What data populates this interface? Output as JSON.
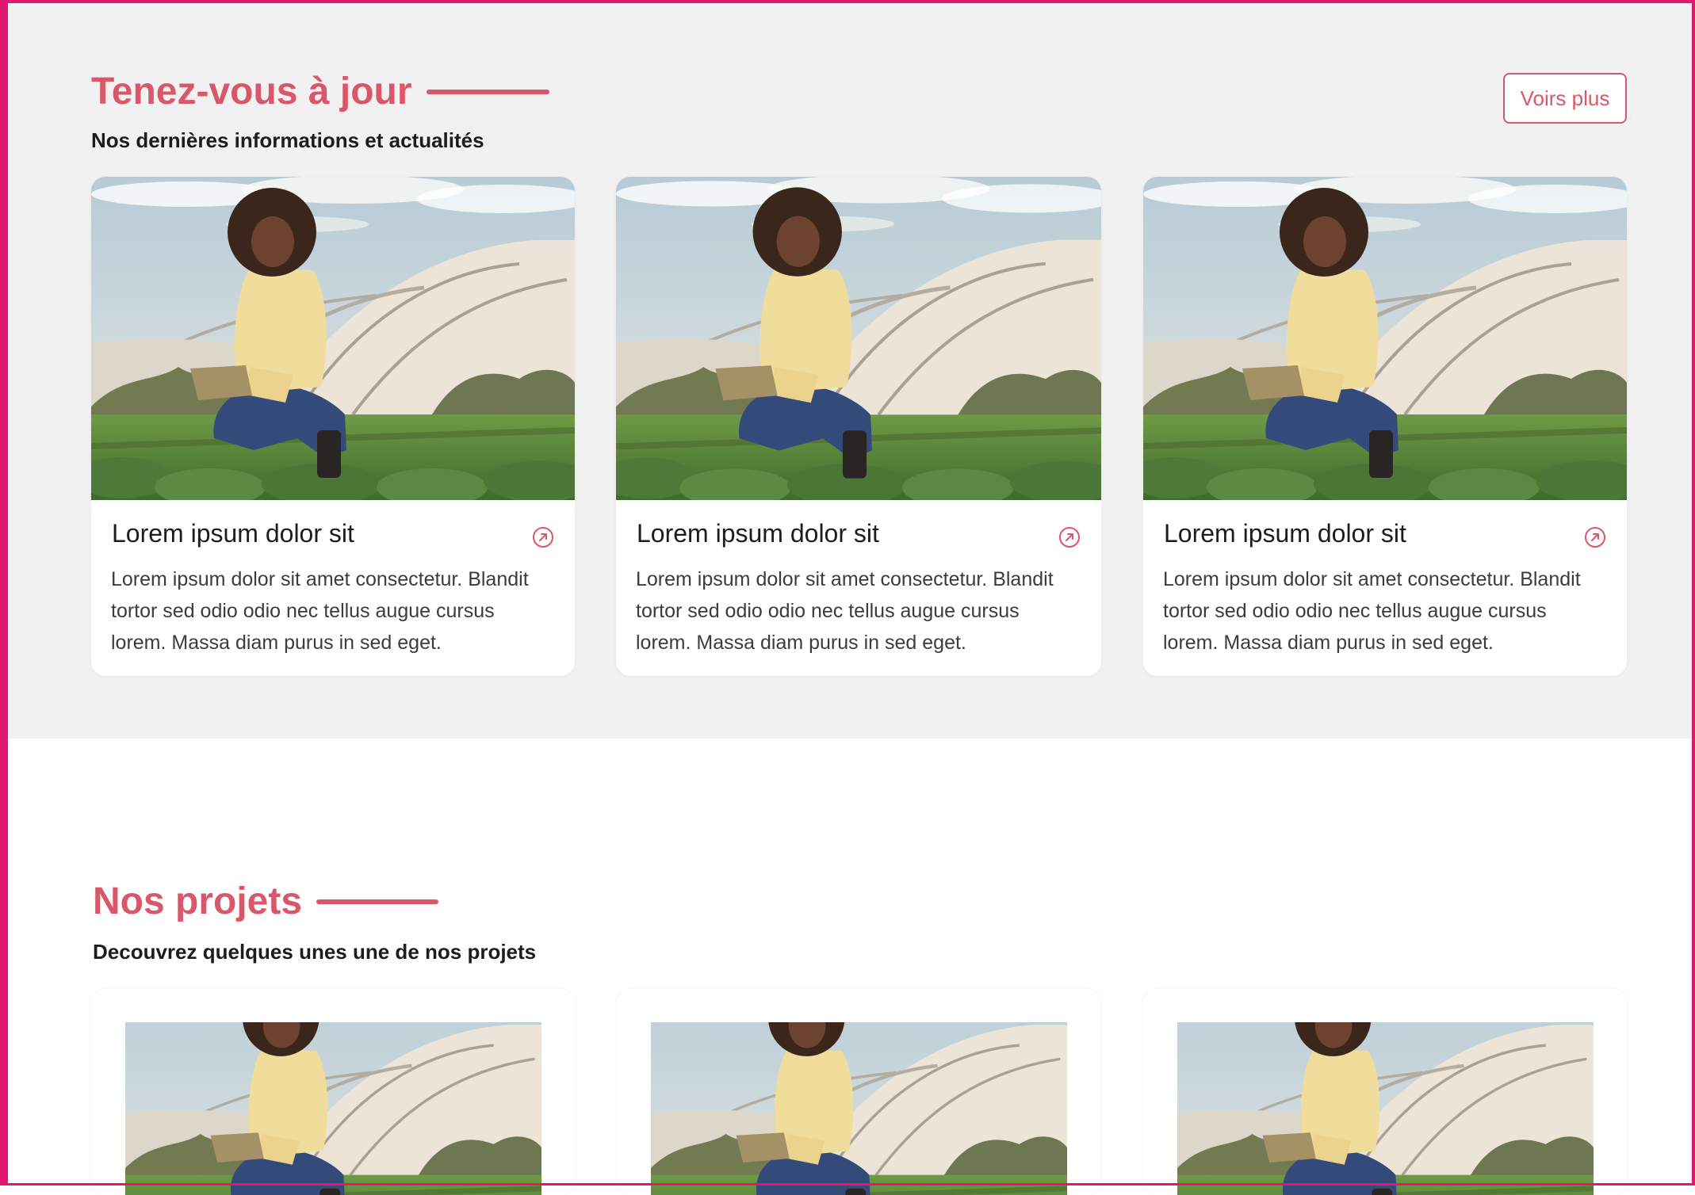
{
  "news": {
    "title": "Tenez-vous à jour",
    "subtitle": "Nos dernières informations et actualités",
    "see_more": "Voirs plus",
    "cards": [
      {
        "title": "Lorem ipsum dolor sit",
        "text": "Lorem ipsum dolor sit amet consectetur. Blandit tortor sed odio odio nec tellus augue cursus lorem. Massa diam purus in sed eget."
      },
      {
        "title": "Lorem ipsum dolor sit",
        "text": "Lorem ipsum dolor sit amet consectetur. Blandit tortor sed odio odio nec tellus augue cursus lorem. Massa diam purus in sed eget."
      },
      {
        "title": "Lorem ipsum dolor sit",
        "text": "Lorem ipsum dolor sit amet consectetur. Blandit tortor sed odio odio nec tellus augue cursus lorem. Massa diam purus in sed eget."
      }
    ]
  },
  "projects": {
    "title": "Nos projets",
    "subtitle": "Decouvrez quelques unes une de nos projets",
    "card_count": 3
  },
  "colors": {
    "accent": "#d9576a",
    "frame": "#e0196e",
    "news_background": "#f1f1f1"
  },
  "icons": {
    "card_link": "arrow-up-right-circle-icon"
  }
}
